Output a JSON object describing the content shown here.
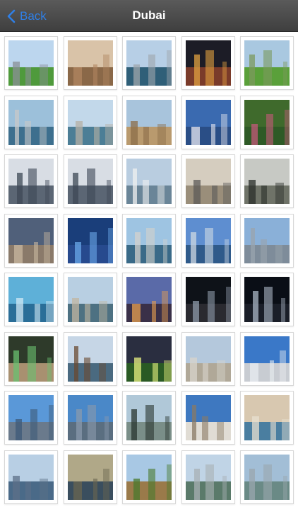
{
  "nav": {
    "back_label": "Back",
    "title": "Dubai"
  },
  "gallery": {
    "photos": [
      {
        "name": "photo-golf-course-skyline",
        "sky": "#bcd6ee",
        "ground": "#4f9a3c",
        "accent": "#8a8f96"
      },
      {
        "name": "photo-mosque-domes",
        "sky": "#d9c3a8",
        "ground": "#8a6848",
        "accent": "#b08660"
      },
      {
        "name": "photo-marina-boats",
        "sky": "#b7cfe6",
        "ground": "#2f5f78",
        "accent": "#9fa5ab"
      },
      {
        "name": "photo-night-skyline",
        "sky": "#1c1c26",
        "ground": "#7a3b2a",
        "accent": "#e0a040"
      },
      {
        "name": "photo-green-park",
        "sky": "#a9c8e0",
        "ground": "#5aa03a",
        "accent": "#7c9a5e"
      },
      {
        "name": "photo-aerial-port",
        "sky": "#9cc0da",
        "ground": "#3d6f8e",
        "accent": "#c8c8c8"
      },
      {
        "name": "photo-creek-aerial",
        "sky": "#c2d8ea",
        "ground": "#4c7e96",
        "accent": "#b6b0a4"
      },
      {
        "name": "photo-camel-statue",
        "sky": "#a8c4dc",
        "ground": "#b99a6e",
        "accent": "#8c6e4a"
      },
      {
        "name": "photo-burj-al-arab",
        "sky": "#3a6ab0",
        "ground": "#2a4e86",
        "accent": "#e8e8f0"
      },
      {
        "name": "photo-peacock",
        "sky": "#3f6a2c",
        "ground": "#2e5a26",
        "accent": "#c45a7a"
      },
      {
        "name": "photo-twin-towers",
        "sky": "#d8dde4",
        "ground": "#5b6674",
        "accent": "#3e4856"
      },
      {
        "name": "photo-twin-towers-2",
        "sky": "#d8dde4",
        "ground": "#5b6674",
        "accent": "#3e4856"
      },
      {
        "name": "photo-dhow-sail-building",
        "sky": "#b9cde0",
        "ground": "#6a8598",
        "accent": "#f0f0f0"
      },
      {
        "name": "photo-terminal-interior",
        "sky": "#d5cdbf",
        "ground": "#9a8e7a",
        "accent": "#5c5a58"
      },
      {
        "name": "photo-palm-hall",
        "sky": "#c7c9c4",
        "ground": "#6f7368",
        "accent": "#2a2e2a"
      },
      {
        "name": "photo-station-curve",
        "sky": "#50607a",
        "ground": "#8a7a6a",
        "accent": "#c8b8a0"
      },
      {
        "name": "photo-metro-blue",
        "sky": "#1a3e7a",
        "ground": "#274a8e",
        "accent": "#6aa8e8"
      },
      {
        "name": "photo-waterfront-towers",
        "sky": "#9ec4e2",
        "ground": "#3a6a88",
        "accent": "#d4d2cc"
      },
      {
        "name": "photo-burj-khalifa-day",
        "sky": "#5e8ed0",
        "ground": "#2f5a8a",
        "accent": "#cfd8e2"
      },
      {
        "name": "photo-burj-khalifa-sky",
        "sky": "#8ab0d8",
        "ground": "#7e8c9a",
        "accent": "#9aa4ae"
      },
      {
        "name": "photo-glass-atrium",
        "sky": "#5eb0d8",
        "ground": "#2a6e98",
        "accent": "#d0e8f4"
      },
      {
        "name": "photo-creek-towers",
        "sky": "#b8cfe2",
        "ground": "#4d7182",
        "accent": "#c2b5a0"
      },
      {
        "name": "photo-city-dusk",
        "sky": "#5a6aa8",
        "ground": "#3a3048",
        "accent": "#e8a050"
      },
      {
        "name": "photo-night-sculpture",
        "sky": "#0e1218",
        "ground": "#2a2a30",
        "accent": "#8e9aa8"
      },
      {
        "name": "photo-night-tower",
        "sky": "#0a0e16",
        "ground": "#1a1e28",
        "accent": "#aab6c4"
      },
      {
        "name": "photo-arched-tunnel",
        "sky": "#2e3a2a",
        "ground": "#a89070",
        "accent": "#6ac070"
      },
      {
        "name": "photo-abra-boat",
        "sky": "#c6d6e6",
        "ground": "#4a6a80",
        "accent": "#6a4a30"
      },
      {
        "name": "photo-night-garden",
        "sky": "#2a2e40",
        "ground": "#2a5a24",
        "accent": "#e8f080"
      },
      {
        "name": "photo-city-plane",
        "sky": "#b4c8dc",
        "ground": "#b0a898",
        "accent": "#d8d4cc"
      },
      {
        "name": "photo-curved-tower",
        "sky": "#3a78c8",
        "ground": "#c8ccd2",
        "accent": "#e8ecf0"
      },
      {
        "name": "photo-blue-tower",
        "sky": "#5a98d8",
        "ground": "#6a7a8c",
        "accent": "#3e5a78"
      },
      {
        "name": "photo-tilted-tower",
        "sky": "#4a88c8",
        "ground": "#5a6e80",
        "accent": "#8a9aac"
      },
      {
        "name": "photo-glass-lamp",
        "sky": "#b0c8d8",
        "ground": "#7a8e88",
        "accent": "#2a3630"
      },
      {
        "name": "photo-jumeirah-mosque",
        "sky": "#3e78c0",
        "ground": "#e0dcd4",
        "accent": "#8a7a64"
      },
      {
        "name": "photo-creek-houses",
        "sky": "#d8c8b0",
        "ground": "#4a7ea0",
        "accent": "#e8e0d0"
      },
      {
        "name": "photo-curved-building",
        "sky": "#b8cfe4",
        "ground": "#4a6a88",
        "accent": "#5e7088"
      },
      {
        "name": "photo-creek-dusk",
        "sky": "#b0a888",
        "ground": "#3a4e5e",
        "accent": "#6a6650"
      },
      {
        "name": "photo-palm-trees",
        "sky": "#a8c8e4",
        "ground": "#9a7a4a",
        "accent": "#4a7a2e"
      },
      {
        "name": "photo-waterfront-skyline",
        "sky": "#c0d4e6",
        "ground": "#5a7a6a",
        "accent": "#a8b0b4"
      },
      {
        "name": "photo-harbor-towers",
        "sky": "#a2bed6",
        "ground": "#6a8a86",
        "accent": "#9aa6ae"
      }
    ]
  }
}
